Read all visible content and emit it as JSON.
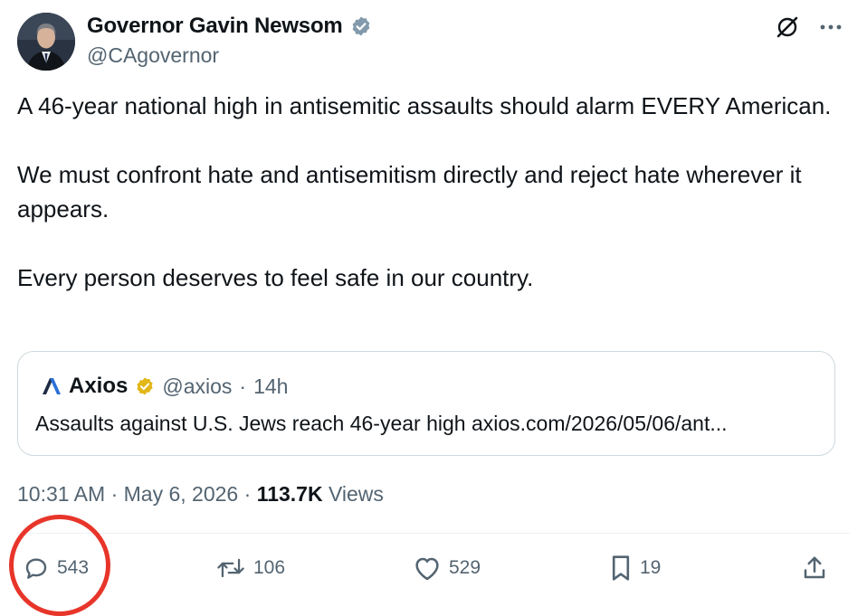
{
  "author": {
    "display_name": "Governor Gavin Newsom",
    "handle": "@CAgovernor",
    "verified": true,
    "verified_badge_color": "#829aab"
  },
  "top_icons": [
    "grok-icon",
    "more-icon"
  ],
  "tweet": {
    "paragraphs": [
      "A 46-year national high in antisemitic assaults should alarm EVERY American.",
      "We must confront hate and antisemitism directly and reject hate wherever it appears.",
      "Every person deserves to feel safe in our country."
    ]
  },
  "quote": {
    "name": "Axios",
    "handle": "@axios",
    "separator": "·",
    "time": "14h",
    "verified_badge_color": "#e2b719",
    "text": "Assaults against U.S. Jews reach 46-year high axios.com/2026/05/06/ant..."
  },
  "meta": {
    "time": "10:31 AM",
    "separator": "·",
    "date": "May 6, 2026",
    "separator2": "·",
    "views_count": "113.7K",
    "views_label": "Views"
  },
  "actions": {
    "replies": "543",
    "reposts": "106",
    "likes": "529",
    "bookmarks": "19"
  },
  "colors": {
    "text": "#0f1419",
    "secondary": "#536471",
    "annotation_circle": "#e8352a"
  }
}
